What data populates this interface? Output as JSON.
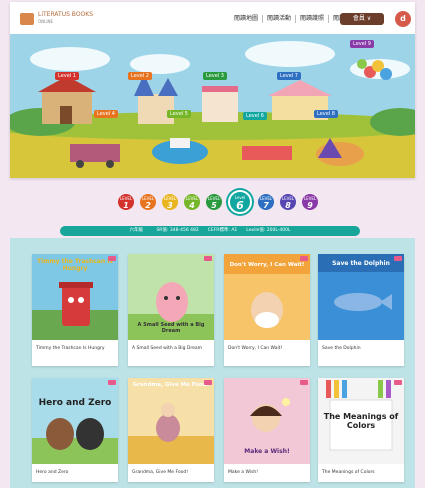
{
  "header": {
    "logo_text": "LiTERATUS BOOKS",
    "logo_sub": "ONLINE",
    "nav_links": [
      "閱讀地圖",
      "閱讀活動",
      "閱讀護照",
      "閱讀報告"
    ],
    "member_label": "會員 ∨",
    "avatar_letter": "d"
  },
  "map_levels": [
    "Level 1",
    "Level 2",
    "Level 3",
    "Level 4",
    "Level 5",
    "Level 6",
    "Level 7",
    "Level 8",
    "Level 9"
  ],
  "level_selector": {
    "items": [
      {
        "label": "LEVEL",
        "num": "1",
        "color": "#d4322c"
      },
      {
        "label": "LEVEL",
        "num": "2",
        "color": "#e8731f"
      },
      {
        "label": "LEVEL",
        "num": "3",
        "color": "#e8b51f"
      },
      {
        "label": "LEVEL",
        "num": "4",
        "color": "#75b628"
      },
      {
        "label": "LEVEL",
        "num": "5",
        "color": "#2a9a3e"
      },
      {
        "label": "Level",
        "num": "6",
        "color": "#12a6a0"
      },
      {
        "label": "LEVEL",
        "num": "7",
        "color": "#2f6fc2"
      },
      {
        "label": "LEVEL",
        "num": "8",
        "color": "#5646b2"
      },
      {
        "label": "LEVEL",
        "num": "9",
        "color": "#8a3aa8"
      }
    ],
    "active_index": 5
  },
  "info_bar": "六年級　　　SR值: 348-456 482　　CEFR標準: A1　　Lexile值: 200L-400L",
  "books": [
    {
      "title": "Timmy the Trashcan Is Hungry",
      "cover_title": "Timmy the Trashcan Is Hungry"
    },
    {
      "title": "A Small Seed with a Big Dream",
      "cover_title": "A Small Seed with a Big Dream"
    },
    {
      "title": "Don't Worry, I Can Wait!",
      "cover_title": "Don't Worry, I Can Wait!"
    },
    {
      "title": "Save the Dolphin",
      "cover_title": "Save the Dolphin"
    },
    {
      "title": "Hero and Zero",
      "cover_title": "Hero and Zero"
    },
    {
      "title": "Grandma, Give Me Food!",
      "cover_title": "Grandma, Give Me Food!"
    },
    {
      "title": "Make a Wish!",
      "cover_title": "Make a Wish!"
    },
    {
      "title": "The Meanings of Colors",
      "cover_title": "The Meanings of Colors"
    }
  ]
}
